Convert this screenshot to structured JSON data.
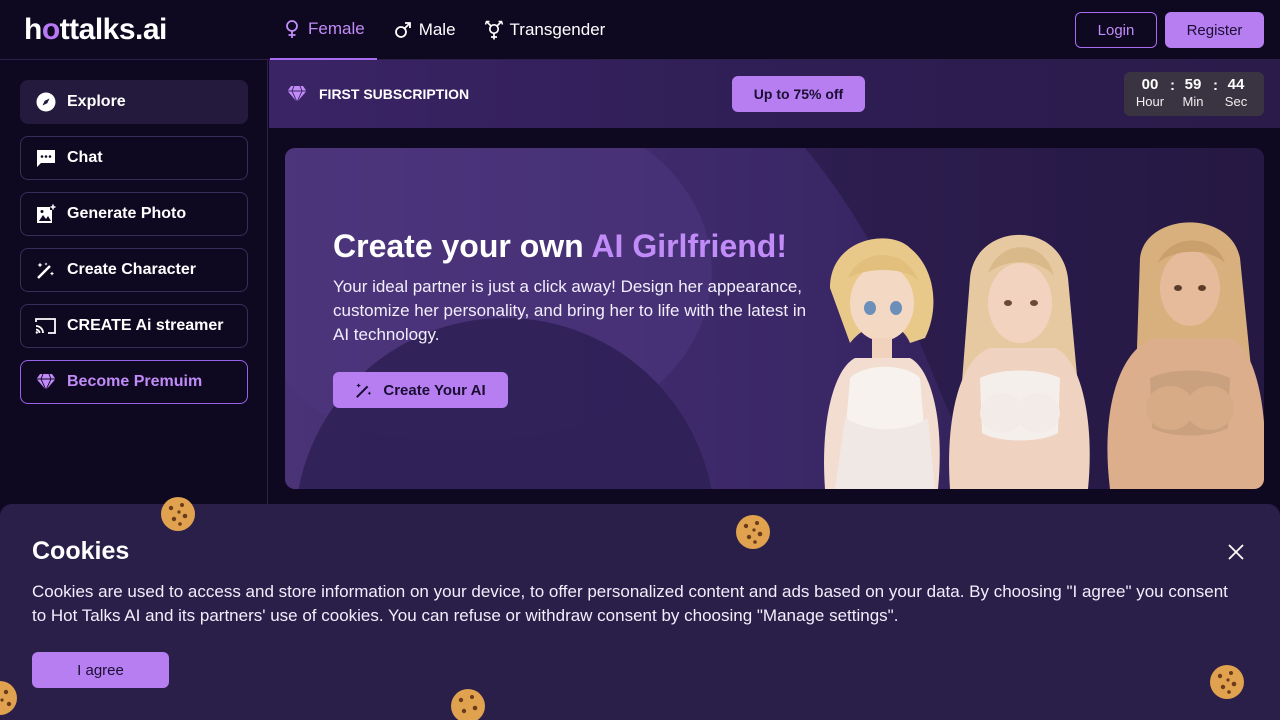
{
  "header": {
    "logo": {
      "part1": "h",
      "part2": "o",
      "part3": "ttalks.ai"
    },
    "gender_tabs": [
      {
        "label": "Female",
        "icon": "female-icon",
        "active": true
      },
      {
        "label": "Male",
        "icon": "male-icon",
        "active": false
      },
      {
        "label": "Transgender",
        "icon": "transgender-icon",
        "active": false
      }
    ],
    "login_label": "Login",
    "register_label": "Register"
  },
  "sidebar": {
    "items": [
      {
        "label": "Explore",
        "icon": "compass-icon"
      },
      {
        "label": "Chat",
        "icon": "chat-icon"
      },
      {
        "label": "Generate Photo",
        "icon": "image-plus-icon"
      },
      {
        "label": "Create Character",
        "icon": "magic-wand-icon"
      },
      {
        "label": "CREATE Ai streamer",
        "icon": "cast-icon"
      },
      {
        "label": "Become Premuim",
        "icon": "diamond-icon"
      }
    ]
  },
  "subscription": {
    "label": "FIRST SUBSCRIPTION",
    "offer_label": "Up to 75% off",
    "timer": {
      "hours": "00",
      "hours_label": "Hour",
      "minutes": "59",
      "minutes_label": "Min",
      "seconds": "44",
      "seconds_label": "Sec",
      "separator": ":"
    }
  },
  "hero": {
    "title_prefix": "Create your own ",
    "title_highlight": "AI Girlfriend!",
    "description": "Your ideal partner is just a click away! Design her appearance, customize her personality, and bring her to life with the latest in AI technology.",
    "cta_label": "Create Your AI"
  },
  "cookie_banner": {
    "title": "Cookies",
    "text": "Cookies are used to access and store information on your device, to offer personalized content and ads based on your data. By choosing \"I agree\" you consent to Hot Talks AI and its partners' use of cookies. You can refuse or withdraw consent by choosing \"Manage settings\".",
    "agree_label": "I agree"
  },
  "colors": {
    "accent": "#b77ef2",
    "accent_text": "#c28cf8",
    "background": "#0e0820",
    "banner_bg": "#2a1f49"
  }
}
